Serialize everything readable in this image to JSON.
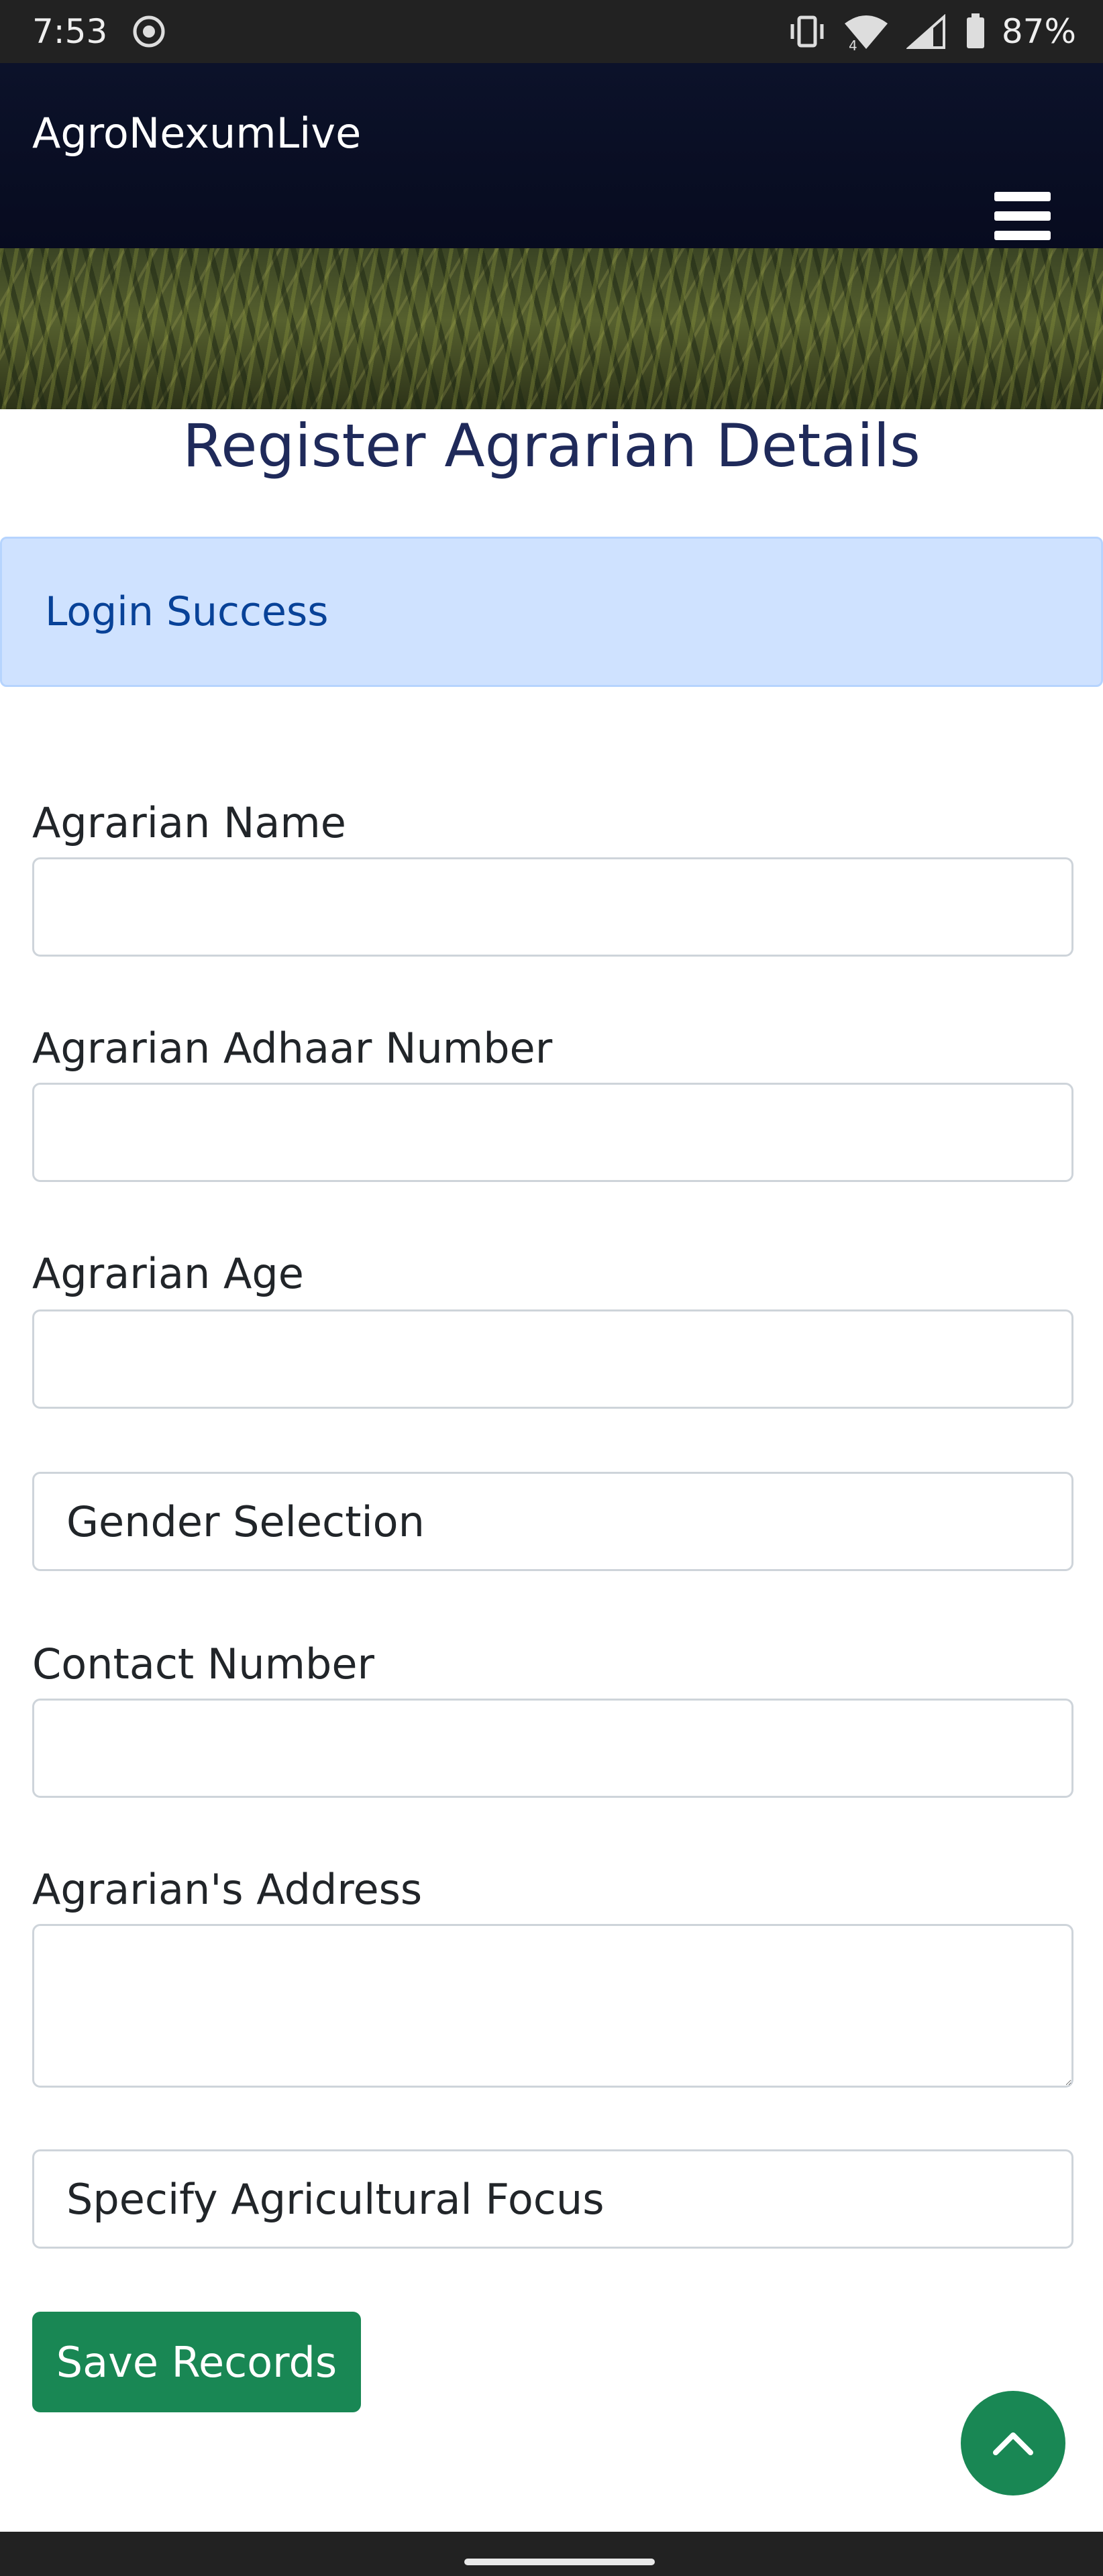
{
  "status_bar": {
    "time": "7:53",
    "battery": "87%",
    "network_type": "4",
    "icons": [
      "record-icon",
      "vibrate-icon",
      "wifi-icon",
      "signal-icon",
      "battery-icon"
    ]
  },
  "navbar": {
    "brand": "AgroNexumLive",
    "menu_icon": "hamburger-menu-icon"
  },
  "page": {
    "title": "Register Agrarian Details",
    "alert": "Login Success"
  },
  "form": {
    "name_label": "Agrarian Name",
    "name_value": "",
    "aadhaar_label": "Agrarian Adhaar Number",
    "aadhaar_value": "",
    "age_label": "Agrarian Age",
    "age_value": "",
    "gender_selected": "Gender Selection",
    "contact_label": "Contact Number",
    "contact_value": "",
    "address_label": "Agrarian's Address",
    "address_value": "",
    "focus_selected": "Specify Agricultural Focus",
    "save_label": "Save Records"
  },
  "floating": {
    "scroll_top_icon": "chevron-up-icon"
  },
  "colors": {
    "navbar_bg": "#0b1128",
    "title": "#1f2a5a",
    "alert_bg": "#cfe2ff",
    "alert_text": "#084298",
    "primary_green": "#198754",
    "status_bar_bg": "#222222"
  }
}
